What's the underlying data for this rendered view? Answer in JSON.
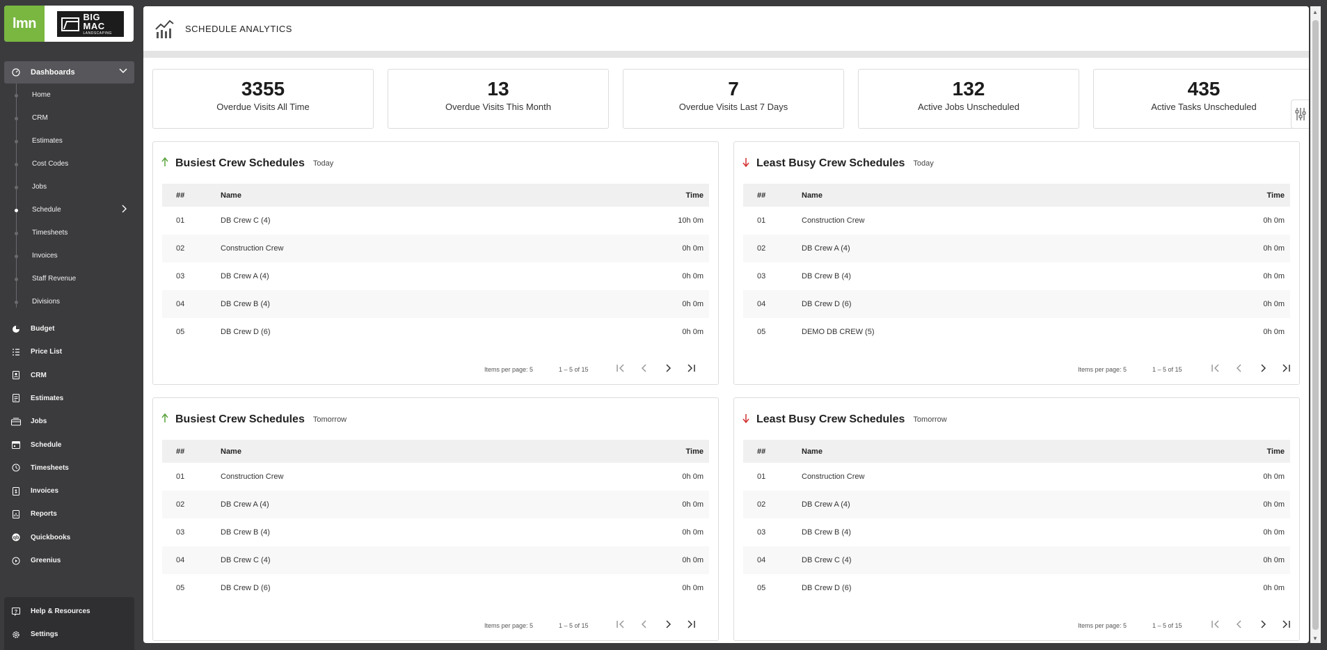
{
  "brand": {
    "lmn": "lmn",
    "company_big": "BIG MAC",
    "company_small": "LANDSCAPING"
  },
  "sidebar": {
    "group": {
      "label": "Dashboards",
      "icon": "dashboard-icon"
    },
    "subitems": [
      "Home",
      "CRM",
      "Estimates",
      "Cost Codes",
      "Jobs",
      "Schedule",
      "Timesheets",
      "Invoices",
      "Staff Revenue",
      "Divisions"
    ],
    "active_subitem": "Schedule",
    "items": [
      {
        "label": "Budget",
        "icon": "pie-chart-icon"
      },
      {
        "label": "Price List",
        "icon": "list-icon"
      },
      {
        "label": "CRM",
        "icon": "contact-icon"
      },
      {
        "label": "Estimates",
        "icon": "estimate-icon"
      },
      {
        "label": "Jobs",
        "icon": "jobs-icon"
      },
      {
        "label": "Schedule",
        "icon": "calendar-icon"
      },
      {
        "label": "Timesheets",
        "icon": "clock-icon"
      },
      {
        "label": "Invoices",
        "icon": "invoice-icon"
      },
      {
        "label": "Reports",
        "icon": "report-icon"
      },
      {
        "label": "Quickbooks",
        "icon": "quickbooks-icon"
      },
      {
        "label": "Greenius",
        "icon": "play-circle-icon"
      }
    ],
    "bottom": [
      {
        "label": "Help & Resources",
        "icon": "help-icon"
      },
      {
        "label": "Settings",
        "icon": "gear-icon"
      }
    ]
  },
  "header": {
    "title": "SCHEDULE ANALYTICS"
  },
  "stats": [
    {
      "value": "3355",
      "label": "Overdue Visits All Time"
    },
    {
      "value": "13",
      "label": "Overdue Visits This Month"
    },
    {
      "value": "7",
      "label": "Overdue Visits Last 7 Days"
    },
    {
      "value": "132",
      "label": "Active Jobs Unscheduled"
    },
    {
      "value": "435",
      "label": "Active Tasks Unscheduled"
    }
  ],
  "table_headers": {
    "idx": "##",
    "name": "Name",
    "time": "Time"
  },
  "pager": {
    "items_per_page": "Items per page: 5",
    "range": "1 – 5 of 15"
  },
  "panels": [
    {
      "title": "Busiest Crew Schedules",
      "when": "Today",
      "direction": "up",
      "rows": [
        [
          "01",
          "DB Crew C (4)",
          "10h 0m"
        ],
        [
          "02",
          "Construction Crew",
          "0h 0m"
        ],
        [
          "03",
          "DB Crew A (4)",
          "0h 0m"
        ],
        [
          "04",
          "DB Crew B (4)",
          "0h 0m"
        ],
        [
          "05",
          "DB Crew D (6)",
          "0h 0m"
        ]
      ]
    },
    {
      "title": "Least Busy Crew Schedules",
      "when": "Today",
      "direction": "down",
      "rows": [
        [
          "01",
          "Construction Crew",
          "0h 0m"
        ],
        [
          "02",
          "DB Crew A (4)",
          "0h 0m"
        ],
        [
          "03",
          "DB Crew B (4)",
          "0h 0m"
        ],
        [
          "04",
          "DB Crew D (6)",
          "0h 0m"
        ],
        [
          "05",
          "DEMO DB CREW (5)",
          "0h 0m"
        ]
      ]
    },
    {
      "title": "Busiest Crew Schedules",
      "when": "Tomorrow",
      "direction": "up",
      "rows": [
        [
          "01",
          "Construction Crew",
          "0h 0m"
        ],
        [
          "02",
          "DB Crew A (4)",
          "0h 0m"
        ],
        [
          "03",
          "DB Crew B (4)",
          "0h 0m"
        ],
        [
          "04",
          "DB Crew C (4)",
          "0h 0m"
        ],
        [
          "05",
          "DB Crew D (6)",
          "0h 0m"
        ]
      ]
    },
    {
      "title": "Least Busy Crew Schedules",
      "when": "Tomorrow",
      "direction": "down",
      "rows": [
        [
          "01",
          "Construction Crew",
          "0h 0m"
        ],
        [
          "02",
          "DB Crew A (4)",
          "0h 0m"
        ],
        [
          "03",
          "DB Crew B (4)",
          "0h 0m"
        ],
        [
          "04",
          "DB Crew C (4)",
          "0h 0m"
        ],
        [
          "05",
          "DB Crew D (6)",
          "0h 0m"
        ]
      ]
    }
  ],
  "colors": {
    "accent_green": "#79b740",
    "up": "#5aa33c",
    "down": "#d32f2f",
    "sidebar_bg": "#3b3b3e"
  }
}
